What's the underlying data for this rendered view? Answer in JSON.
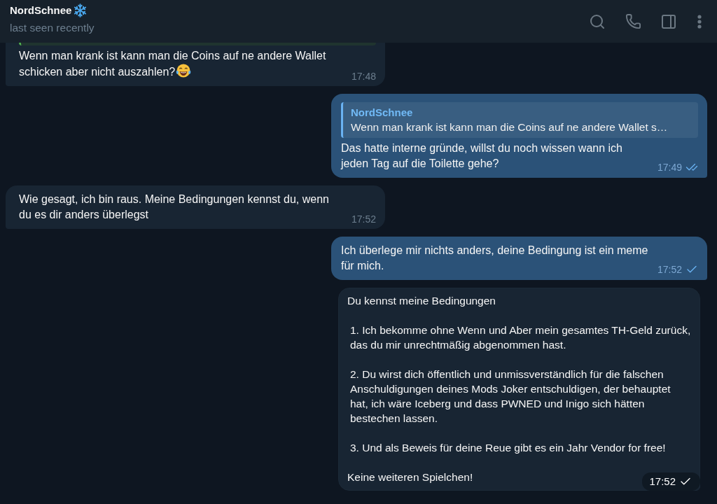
{
  "header": {
    "name": "NordSchnee",
    "name_emoji": true,
    "status": "last seen recently"
  },
  "messages": [
    {
      "kind": "text",
      "outgoing": false,
      "clipped_reply": true,
      "text": "Wenn man krank ist kann man die Coins auf ne andere Wallet schicken aber nicht auszahlen?",
      "trailing_emoji": true,
      "time": "17:48"
    },
    {
      "kind": "text",
      "outgoing": true,
      "reply": {
        "author": "NordSchnee",
        "text": "Wenn man krank ist kann man die Coins auf ne andere Wallet s…"
      },
      "text": "Das hatte interne gründe, willst du noch wissen wann ich jeden Tag auf die Toilette gehe?",
      "time": "17:49",
      "read": true
    },
    {
      "kind": "text",
      "outgoing": false,
      "text": "Wie gesagt, ich bin raus. Meine Bedingungen kennst du, wenn du es dir anders überlegst",
      "time": "17:52"
    },
    {
      "kind": "text",
      "outgoing": true,
      "text": "Ich überlege mir nichts anders, deine Bedingung ist ein meme für mich.",
      "time": "17:52",
      "read": false
    },
    {
      "kind": "image",
      "outgoing": true,
      "paragraphs": [
        {
          "kind": "text",
          "text": "Du kennst meine Bedingungen"
        },
        {
          "kind": "item",
          "text": "1. Ich bekomme ohne Wenn und Aber mein gesamtes TH-Geld zurück, das du mir unrechtmäßig abgenommen hast."
        },
        {
          "kind": "item",
          "text": "2. Du wirst dich öffentlich und unmissverständlich für die falschen Anschuldigungen deines Mods Joker entschuldigen, der behauptet hat, ich wäre Iceberg und dass PWNED und Inigo sich hätten bestechen lassen."
        },
        {
          "kind": "item",
          "text": "3. Und als Beweis für deine Reue gibt es ein Jahr Vendor for free!"
        },
        {
          "kind": "text",
          "text": "Keine weiteren Spielchen!"
        }
      ],
      "time": "17:52",
      "read": false
    }
  ]
}
